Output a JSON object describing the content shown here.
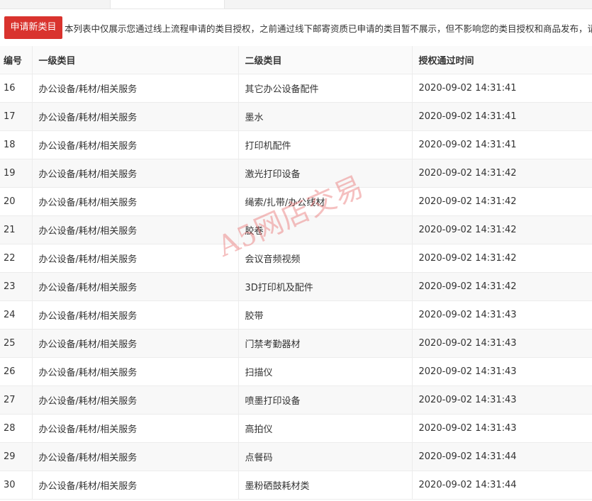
{
  "toolbar": {
    "apply_button_label": "申请新类目",
    "notice_text": "本列表中仅展示您通过线上流程申请的类目授权，之前通过线下邮寄资质已申请的类目暂不展示，但不影响您的类目授权和商品发布，请勿重"
  },
  "table": {
    "headers": [
      "编号",
      "一级类目",
      "二级类目",
      "授权通过时间"
    ],
    "rows": [
      [
        "16",
        "办公设备/耗材/相关服务",
        "其它办公设备配件",
        "2020-09-02 14:31:41"
      ],
      [
        "17",
        "办公设备/耗材/相关服务",
        "墨水",
        "2020-09-02 14:31:41"
      ],
      [
        "18",
        "办公设备/耗材/相关服务",
        "打印机配件",
        "2020-09-02 14:31:41"
      ],
      [
        "19",
        "办公设备/耗材/相关服务",
        "激光打印设备",
        "2020-09-02 14:31:42"
      ],
      [
        "20",
        "办公设备/耗材/相关服务",
        "绳索/扎带/办公线材",
        "2020-09-02 14:31:42"
      ],
      [
        "21",
        "办公设备/耗材/相关服务",
        "胶卷",
        "2020-09-02 14:31:42"
      ],
      [
        "22",
        "办公设备/耗材/相关服务",
        "会议音频视频",
        "2020-09-02 14:31:42"
      ],
      [
        "23",
        "办公设备/耗材/相关服务",
        "3D打印机及配件",
        "2020-09-02 14:31:42"
      ],
      [
        "24",
        "办公设备/耗材/相关服务",
        "胶带",
        "2020-09-02 14:31:43"
      ],
      [
        "25",
        "办公设备/耗材/相关服务",
        "门禁考勤器材",
        "2020-09-02 14:31:43"
      ],
      [
        "26",
        "办公设备/耗材/相关服务",
        "扫描仪",
        "2020-09-02 14:31:43"
      ],
      [
        "27",
        "办公设备/耗材/相关服务",
        "喷墨打印设备",
        "2020-09-02 14:31:43"
      ],
      [
        "28",
        "办公设备/耗材/相关服务",
        "高拍仪",
        "2020-09-02 14:31:43"
      ],
      [
        "29",
        "办公设备/耗材/相关服务",
        "点餐码",
        "2020-09-02 14:31:44"
      ],
      [
        "30",
        "办公设备/耗材/相关服务",
        "墨粉硒鼓耗材类",
        "2020-09-02 14:31:44"
      ]
    ]
  },
  "watermark": {
    "text": "A5网店交易",
    "color": "#e45a5a"
  },
  "colors": {
    "primary_button": "#d9332e",
    "border": "#ececec",
    "row_alt": "#f8f8f8"
  }
}
